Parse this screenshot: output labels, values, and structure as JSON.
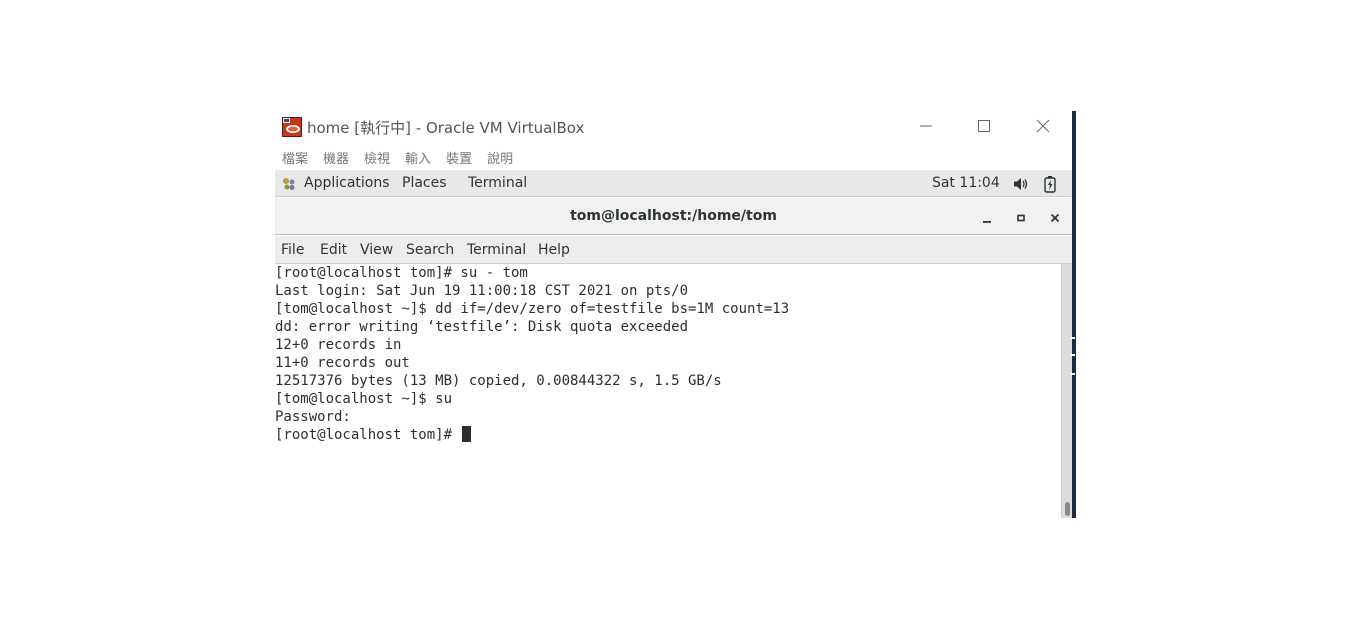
{
  "vbox": {
    "title": "home [執行中] - Oracle VM VirtualBox",
    "menu": [
      "檔案",
      "機器",
      "檢視",
      "輸入",
      "裝置",
      "說明"
    ],
    "icons": {
      "app": "virtualbox-icon",
      "minimize": "minimize-icon",
      "maximize": "maximize-icon",
      "close": "close-icon"
    }
  },
  "gnome": {
    "applications": "Applications",
    "places": "Places",
    "terminal": "Terminal",
    "clock": "Sat 11:04",
    "icons": {
      "apps": "applications-icon",
      "volume": "volume-icon",
      "battery": "battery-icon"
    }
  },
  "terminal": {
    "title": "tom@localhost:/home/tom",
    "menu": [
      "File",
      "Edit",
      "View",
      "Search",
      "Terminal",
      "Help"
    ],
    "lines": [
      "[root@localhost tom]# su - tom",
      "Last login: Sat Jun 19 11:00:18 CST 2021 on pts/0",
      "[tom@localhost ~]$ dd if=/dev/zero of=testfile bs=1M count=13",
      "dd: error writing ‘testfile’: Disk quota exceeded",
      "12+0 records in",
      "11+0 records out",
      "12517376 bytes (13 MB) copied, 0.00844322 s, 1.5 GB/s",
      "[tom@localhost ~]$ su",
      "Password:",
      "[root@localhost tom]# "
    ]
  },
  "colors": {
    "accent": "#1f2a44",
    "topbar": "#e8e8e7",
    "text": "#2e3436"
  }
}
